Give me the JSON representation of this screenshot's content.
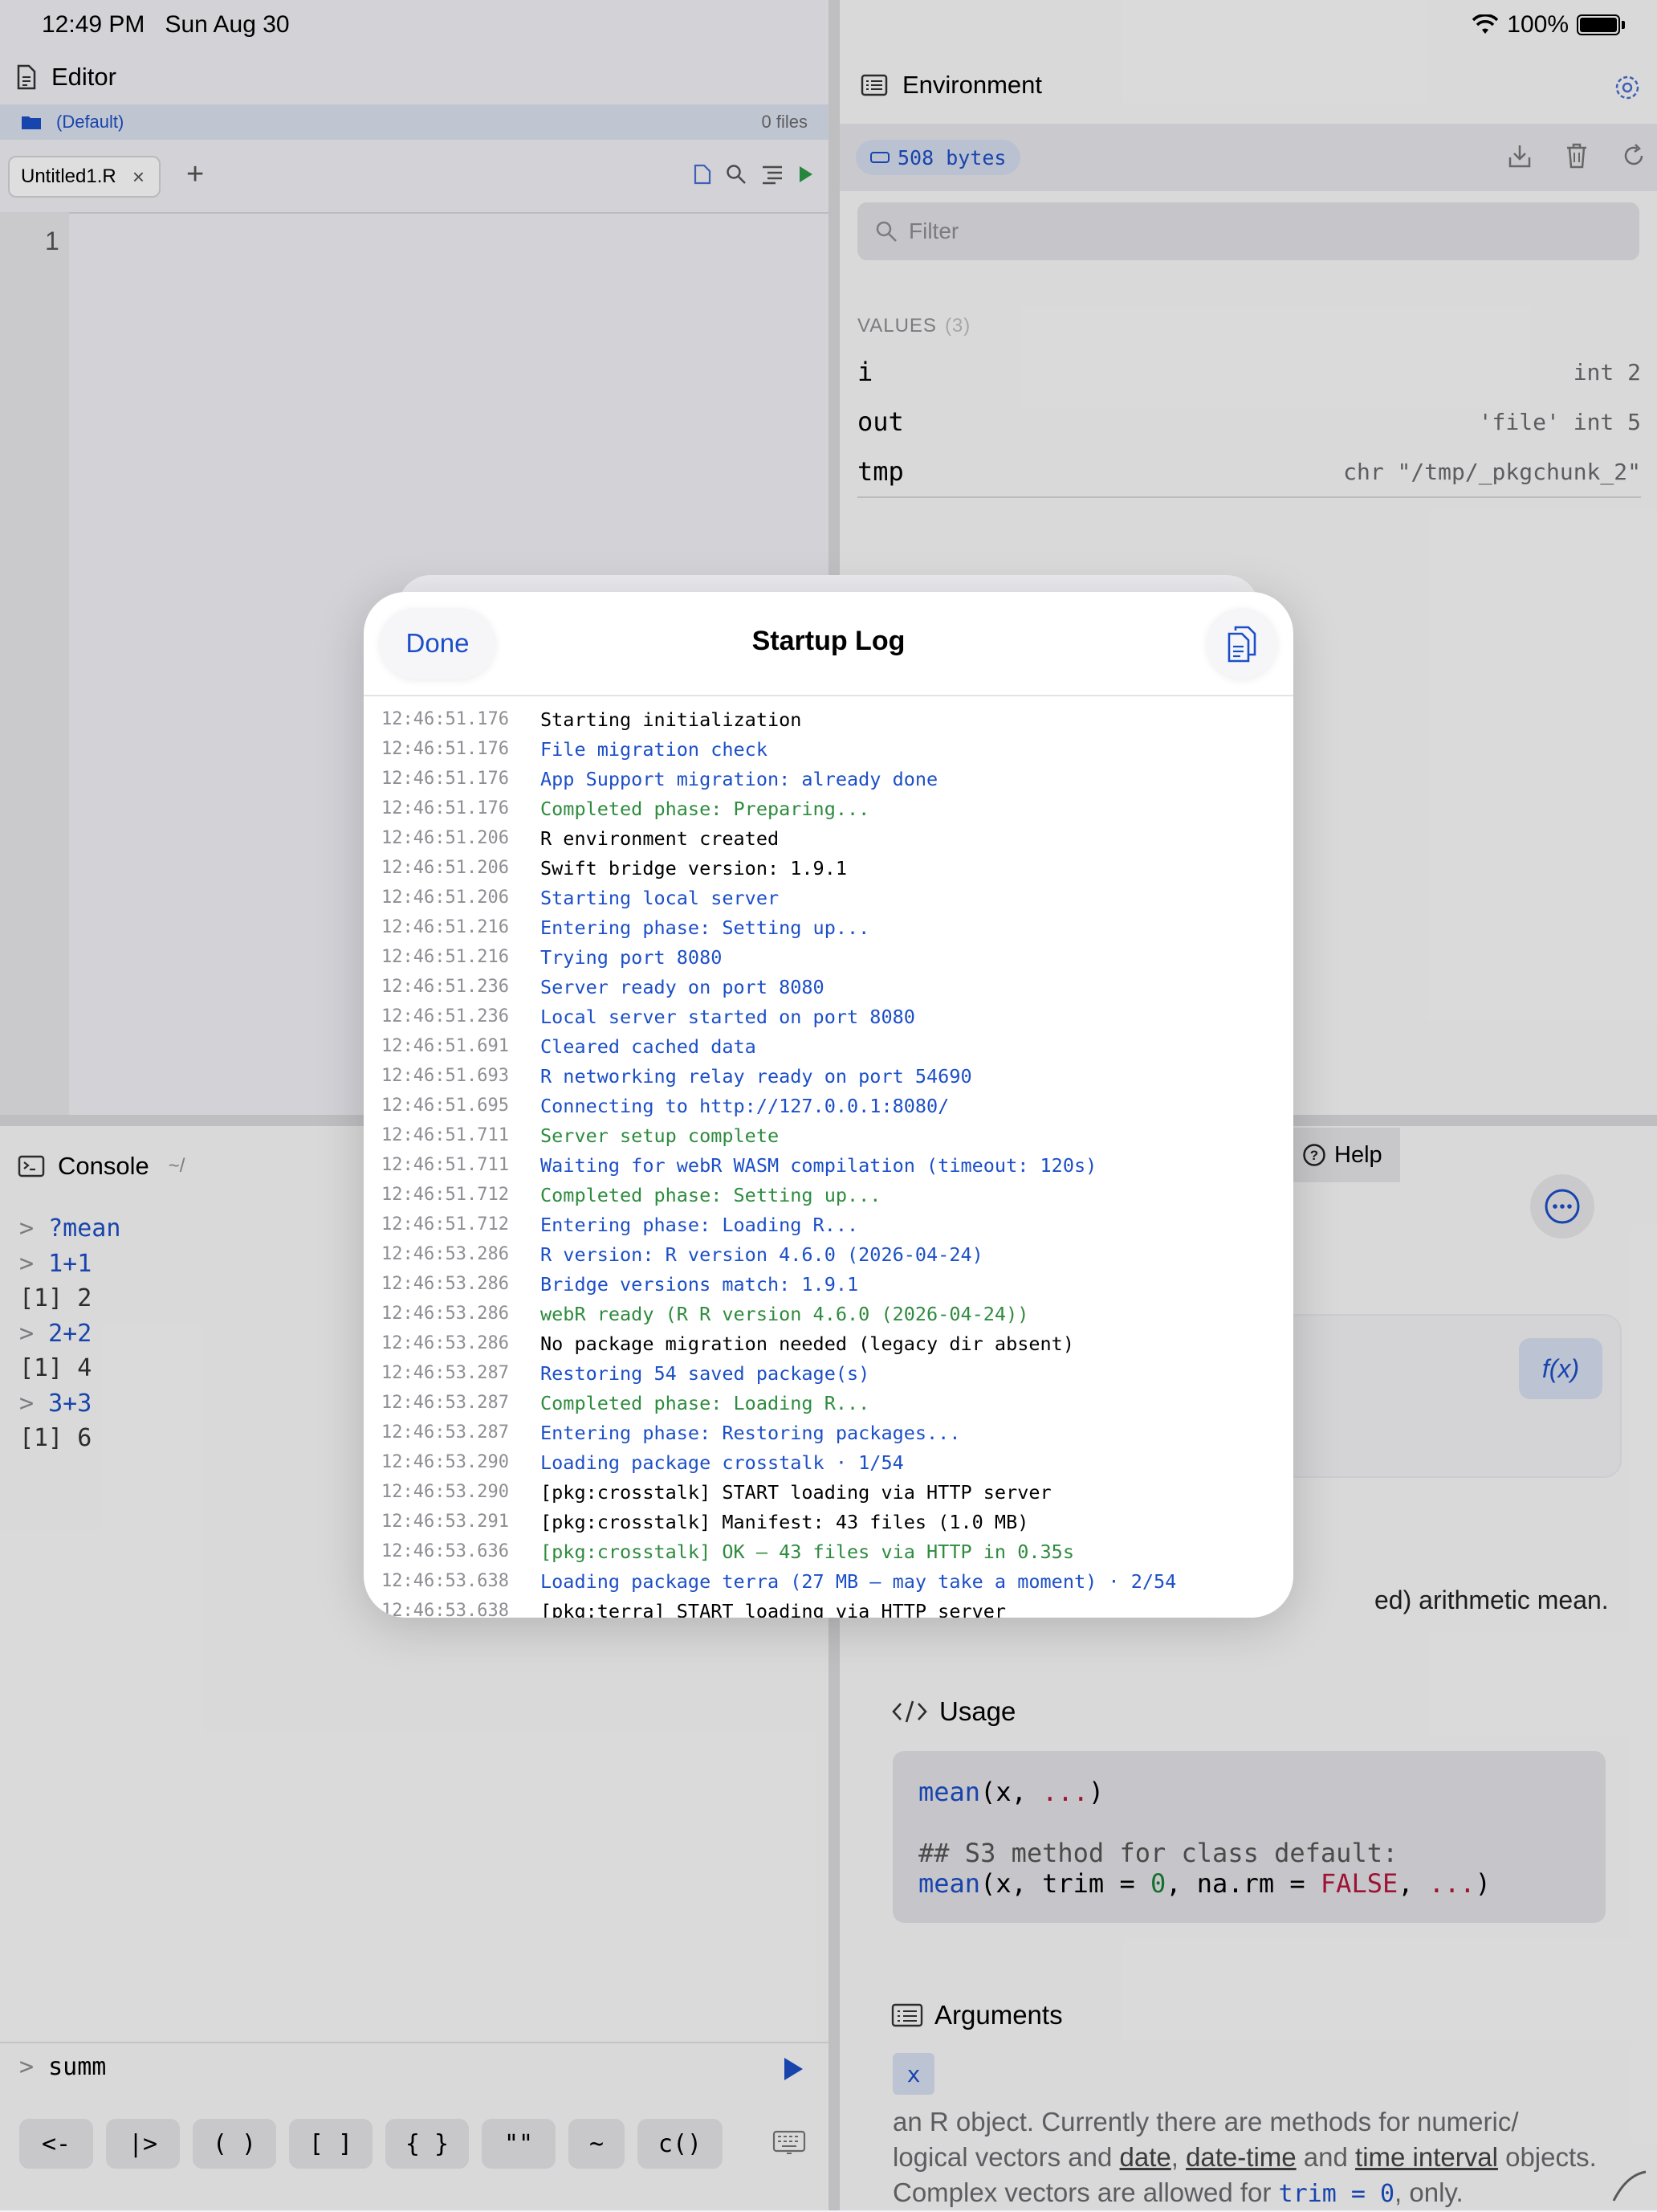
{
  "status": {
    "time": "12:49 PM",
    "date": "Sun Aug 30",
    "battery": "100%"
  },
  "editor": {
    "title": "Editor",
    "project": "(Default)",
    "file_count": "0 files",
    "tab": "Untitled1.R",
    "tab_close": "×",
    "tab_add": "+",
    "line_number": "1"
  },
  "environment": {
    "title": "Environment",
    "memory": "508 bytes",
    "filter_placeholder": "Filter",
    "values_label": "VALUES",
    "values_count": "(3)",
    "variables": [
      {
        "name": "i",
        "value": "int 2"
      },
      {
        "name": "out",
        "value": "'file' int 5"
      },
      {
        "name": "tmp",
        "value": "chr \"/tmp/_pkgchunk_2\""
      }
    ]
  },
  "console": {
    "title": "Console",
    "dir": "~/",
    "prompt_symbol": ">",
    "lines": [
      {
        "prompt": ">",
        "text": "?mean"
      },
      {
        "prompt": ">",
        "text": "1+1"
      },
      {
        "prompt": "",
        "text": "[1] 2"
      },
      {
        "prompt": ">",
        "text": "2+2"
      },
      {
        "prompt": "",
        "text": "[1] 4"
      },
      {
        "prompt": ">",
        "text": "3+3"
      },
      {
        "prompt": "",
        "text": "[1] 6"
      }
    ],
    "input_value": "summ",
    "keys": [
      "<-",
      "|>",
      "( )",
      "[ ]",
      "{ }",
      "\"\"",
      "~",
      "c()"
    ]
  },
  "help": {
    "tab_label": "Help",
    "fx_label": "f(x)",
    "description_partial": "ed) arithmetic mean.",
    "usage_title": "Usage",
    "usage_code": {
      "line1_fn": "mean",
      "line1_args": "(x, ",
      "line1_dots": "...",
      "line1_close": ")",
      "line2": "## S3 method for class default:",
      "line3_fn": "mean",
      "line3_a": "(x, trim = ",
      "line3_num": "0",
      "line3_b": ", na.rm = ",
      "line3_bool": "FALSE",
      "line3_c": ", ",
      "line3_dots": "...",
      "line3_close": ")"
    },
    "arguments_title": "Arguments",
    "arg_name": "x",
    "arg_text_1": "an R object. Currently there are methods for numeric/ logical vectors and ",
    "arg_link_date": "date",
    "arg_sep1": ", ",
    "arg_link_datetime": "date-time",
    "arg_text_2": " and ",
    "arg_link_interval": "time interval",
    "arg_text_3": " objects. Complex vectors are allowed for ",
    "arg_code": "trim = 0",
    "arg_text_4": ", only."
  },
  "modal": {
    "title": "Startup Log",
    "done_label": "Done",
    "colors": {
      "default": "#000000",
      "info": "#1c4fc7",
      "success": "#2e8b3e"
    },
    "log": [
      {
        "ts": "12:46:51.176",
        "msg": "Starting initialization",
        "level": "default"
      },
      {
        "ts": "12:46:51.176",
        "msg": "File migration check",
        "level": "info"
      },
      {
        "ts": "12:46:51.176",
        "msg": "App Support migration: already done",
        "level": "info"
      },
      {
        "ts": "12:46:51.176",
        "msg": "Completed phase: Preparing...",
        "level": "success"
      },
      {
        "ts": "12:46:51.206",
        "msg": "R environment created",
        "level": "default"
      },
      {
        "ts": "12:46:51.206",
        "msg": "Swift bridge version: 1.9.1",
        "level": "default"
      },
      {
        "ts": "12:46:51.206",
        "msg": "Starting local server",
        "level": "info"
      },
      {
        "ts": "12:46:51.216",
        "msg": "Entering phase: Setting up...",
        "level": "info"
      },
      {
        "ts": "12:46:51.216",
        "msg": "Trying port 8080",
        "level": "info"
      },
      {
        "ts": "12:46:51.236",
        "msg": "Server ready on port 8080",
        "level": "info"
      },
      {
        "ts": "12:46:51.236",
        "msg": "Local server started on port 8080",
        "level": "info"
      },
      {
        "ts": "12:46:51.691",
        "msg": "Cleared cached data",
        "level": "info"
      },
      {
        "ts": "12:46:51.693",
        "msg": "R networking relay ready on port 54690",
        "level": "info"
      },
      {
        "ts": "12:46:51.695",
        "msg": "Connecting to http://127.0.0.1:8080/",
        "level": "info"
      },
      {
        "ts": "12:46:51.711",
        "msg": "Server setup complete",
        "level": "success"
      },
      {
        "ts": "12:46:51.711",
        "msg": "Waiting for webR WASM compilation (timeout: 120s)",
        "level": "info"
      },
      {
        "ts": "12:46:51.712",
        "msg": "Completed phase: Setting up...",
        "level": "success"
      },
      {
        "ts": "12:46:51.712",
        "msg": "Entering phase: Loading R...",
        "level": "info"
      },
      {
        "ts": "12:46:53.286",
        "msg": "R version: R version 4.6.0 (2026-04-24)",
        "level": "info"
      },
      {
        "ts": "12:46:53.286",
        "msg": "Bridge versions match: 1.9.1",
        "level": "info"
      },
      {
        "ts": "12:46:53.286",
        "msg": "webR ready (R R version 4.6.0 (2026-04-24))",
        "level": "success"
      },
      {
        "ts": "12:46:53.286",
        "msg": "No package migration needed (legacy dir absent)",
        "level": "default"
      },
      {
        "ts": "12:46:53.287",
        "msg": "Restoring 54 saved package(s)",
        "level": "info"
      },
      {
        "ts": "12:46:53.287",
        "msg": "Completed phase: Loading R...",
        "level": "success"
      },
      {
        "ts": "12:46:53.287",
        "msg": "Entering phase: Restoring packages...",
        "level": "info"
      },
      {
        "ts": "12:46:53.290",
        "msg": "Loading package crosstalk · 1/54",
        "level": "info"
      },
      {
        "ts": "12:46:53.290",
        "msg": "[pkg:crosstalk] START loading via HTTP server",
        "level": "default"
      },
      {
        "ts": "12:46:53.291",
        "msg": "[pkg:crosstalk] Manifest: 43 files (1.0 MB)",
        "level": "default"
      },
      {
        "ts": "12:46:53.636",
        "msg": "[pkg:crosstalk] OK — 43 files via HTTP in 0.35s",
        "level": "success"
      },
      {
        "ts": "12:46:53.638",
        "msg": "Loading package terra (27 MB — may take a moment) · 2/54",
        "level": "info"
      },
      {
        "ts": "12:46:53.638",
        "msg": "[pkg:terra] START loading via HTTP server",
        "level": "default"
      }
    ]
  }
}
